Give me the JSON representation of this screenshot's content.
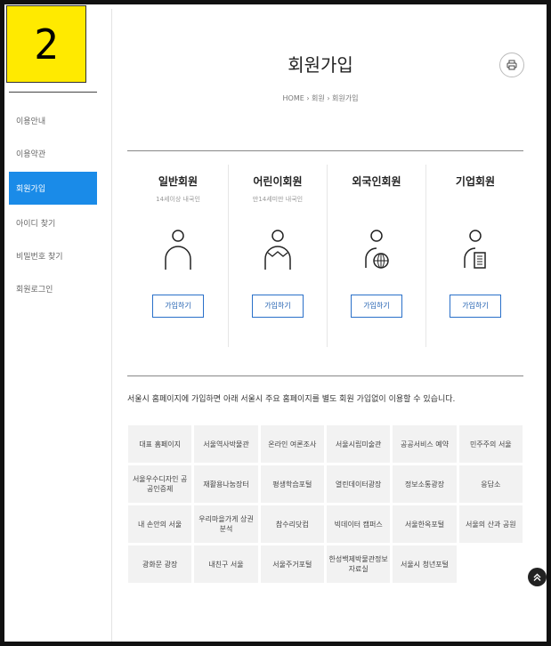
{
  "step_badge": "2",
  "sidebar": {
    "items": [
      {
        "label": "이용안내",
        "active": false
      },
      {
        "label": "이용약관",
        "active": false
      },
      {
        "label": "회원가입",
        "active": true
      },
      {
        "label": "아이디 찾기",
        "active": false
      },
      {
        "label": "비밀번호 찾기",
        "active": false
      },
      {
        "label": "회원로그인",
        "active": false
      }
    ]
  },
  "header": {
    "title": "회원가입",
    "breadcrumb": "HOME › 회원 › 회원가입",
    "print_icon": "printer-icon"
  },
  "member_types": [
    {
      "title": "일반회원",
      "subtitle": "14세이상 내국인",
      "icon": "person-icon",
      "button": "가입하기"
    },
    {
      "title": "어린이회원",
      "subtitle": "만14세미만 내국인",
      "icon": "child-icon",
      "button": "가입하기"
    },
    {
      "title": "외국인회원",
      "subtitle": "",
      "icon": "foreigner-icon",
      "button": "가입하기"
    },
    {
      "title": "기업회원",
      "subtitle": "",
      "icon": "business-icon",
      "button": "가입하기"
    }
  ],
  "notice": "서울시 홈페이지에 가입하면 아래 서울시 주요 홈페이지를 별도 회원 가입없이 이용할 수 있습니다.",
  "sites": [
    "대표 홈페이지",
    "서울역사박물관",
    "온라인 여론조사",
    "서울시립미술관",
    "공공서비스 예약",
    "민주주의 서울",
    "서울우수디자인 공공인증제",
    "재활용나눔장터",
    "평생학습포털",
    "열린데이터광장",
    "정보소통광장",
    "응답소",
    "내 손안의 서울",
    "우리마을가게 상권분석",
    "참수리닷컴",
    "빅데이터 캠퍼스",
    "서울한옥포털",
    "서울의 산과 공원",
    "광화문 광장",
    "내친구 서울",
    "서울주거포털",
    "한성백제박물관정보자료실",
    "서울시 청년포털"
  ],
  "colors": {
    "accent": "#1a8be8",
    "button_border": "#2a70c9",
    "badge": "#ffea00"
  },
  "scroll_top_icon": "double-chevron-up-icon"
}
